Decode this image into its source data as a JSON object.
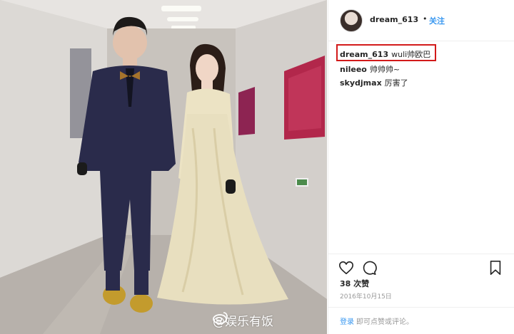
{
  "post": {
    "username": "dream_613",
    "separator": "•",
    "follow_label": "关注"
  },
  "comments": [
    {
      "user": "dream_613",
      "text": "wuli帅欧巴"
    },
    {
      "user": "nileeo",
      "text": "帅帅帅~"
    },
    {
      "user": "skydjmax",
      "text": "厉害了"
    }
  ],
  "actions": {
    "like_icon": "heart-icon",
    "comment_icon": "comment-icon",
    "save_icon": "bookmark-icon",
    "likes_text": "38 次赞",
    "date_text": "2016年10月15日"
  },
  "footer": {
    "login_label": "登录",
    "login_suffix": "即可点赞或评论。"
  },
  "watermark": {
    "text": "@娱乐有饭",
    "icon": "weibo-icon"
  },
  "colors": {
    "accent": "#3897f0",
    "highlight_box": "#d21a1a"
  }
}
